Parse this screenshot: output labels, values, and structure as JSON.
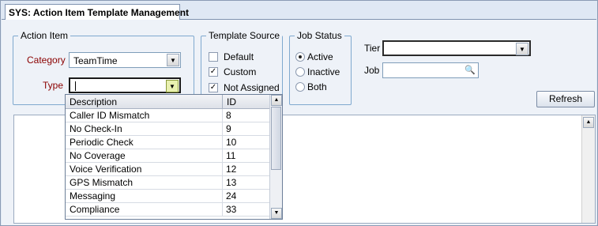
{
  "tab": {
    "title": "SYS: Action Item Template Management"
  },
  "action_item": {
    "title": "Action Item",
    "category_label": "Category",
    "category_value": "TeamTime",
    "type_label": "Type",
    "type_value": ""
  },
  "template_source": {
    "title": "Template Source",
    "options": [
      {
        "label": "Default",
        "checked": false
      },
      {
        "label": "Custom",
        "checked": true
      },
      {
        "label": "Not Assigned",
        "checked": true
      }
    ]
  },
  "job_status": {
    "title": "Job Status",
    "options": [
      {
        "label": "Active",
        "selected": true
      },
      {
        "label": "Inactive",
        "selected": false
      },
      {
        "label": "Both",
        "selected": false
      }
    ]
  },
  "tier": {
    "label": "Tier",
    "value": ""
  },
  "job": {
    "label": "Job",
    "value": ""
  },
  "refresh_button": {
    "label": "Refresh"
  },
  "type_dropdown": {
    "columns": [
      "Description",
      "ID"
    ],
    "rows": [
      {
        "description": "Caller ID Mismatch",
        "id": "8"
      },
      {
        "description": "No Check-In",
        "id": "9"
      },
      {
        "description": "Periodic Check",
        "id": "10"
      },
      {
        "description": "No Coverage",
        "id": "11"
      },
      {
        "description": "Voice Verification",
        "id": "12"
      },
      {
        "description": "GPS Mismatch",
        "id": "13"
      },
      {
        "description": "Messaging",
        "id": "24"
      },
      {
        "description": "Compliance",
        "id": "33"
      }
    ]
  },
  "icons": {
    "dropdown_arrow": "chevron-down-icon",
    "search": "binoculars-icon",
    "scroll_up": "arrow-up-icon",
    "scroll_down": "arrow-down-icon"
  }
}
